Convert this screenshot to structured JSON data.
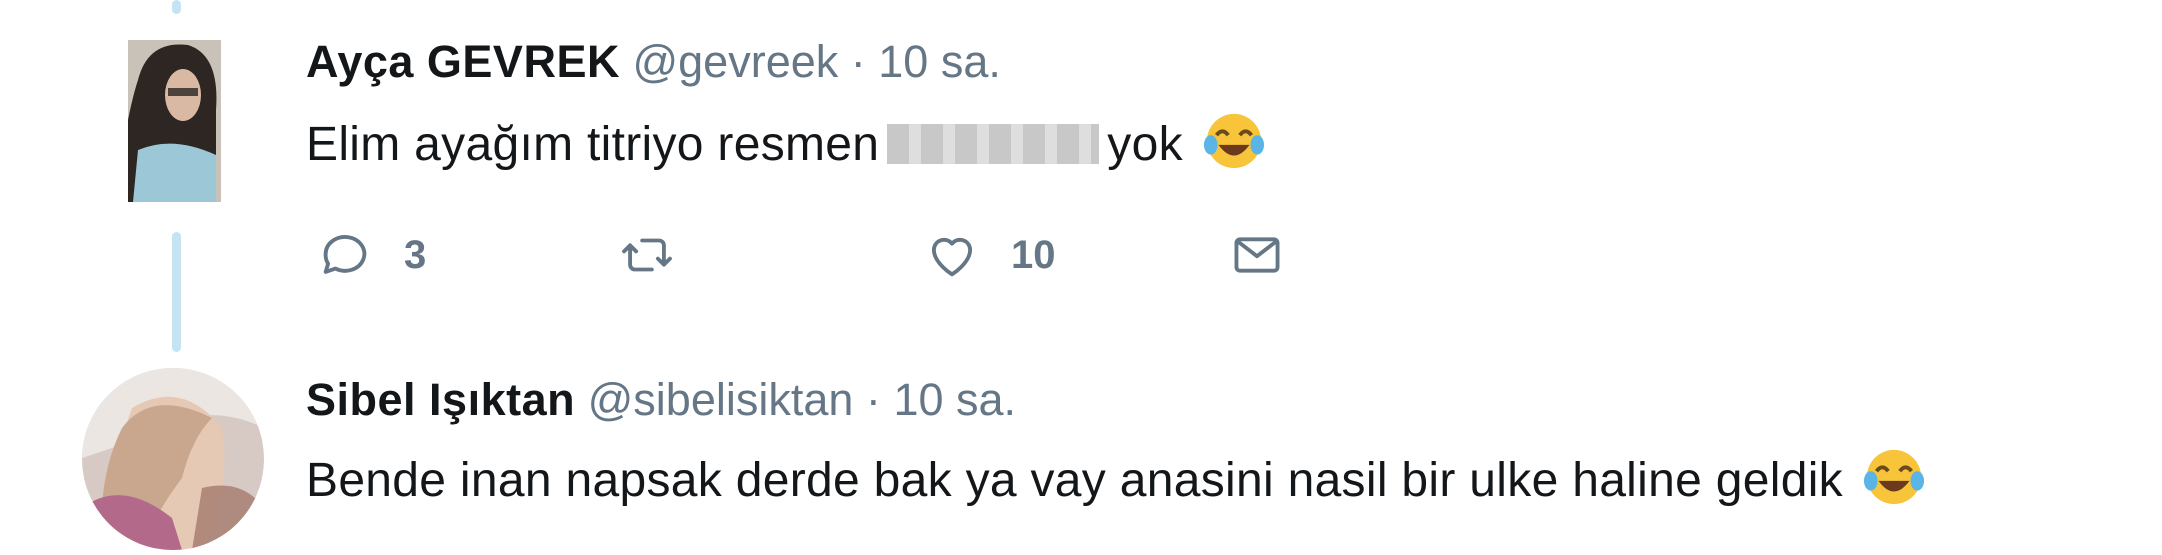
{
  "tweets": [
    {
      "name": "Ayça GEVREK",
      "handle": "@gevreek",
      "separator": "·",
      "time": "10 sa.",
      "text_before": "Elim ayağım titriyo resmen",
      "text_after": "yok",
      "emoji_icon": "face-with-tears-of-joy-icon",
      "actions": {
        "reply_count": "3",
        "retweet_count": "",
        "like_count": "10"
      }
    },
    {
      "name": "Sibel Işıktan",
      "handle": "@sibelisiktan",
      "separator": "·",
      "time": "10 sa.",
      "text": "Bende inan napsak derde bak ya vay anasini nasil bir ulke haline geldik",
      "emoji_icon": "face-with-tears-of-joy-icon"
    }
  ],
  "colors": {
    "thread_line": "#c4e3f3",
    "secondary_text": "#657786",
    "primary_text": "#14171a"
  }
}
